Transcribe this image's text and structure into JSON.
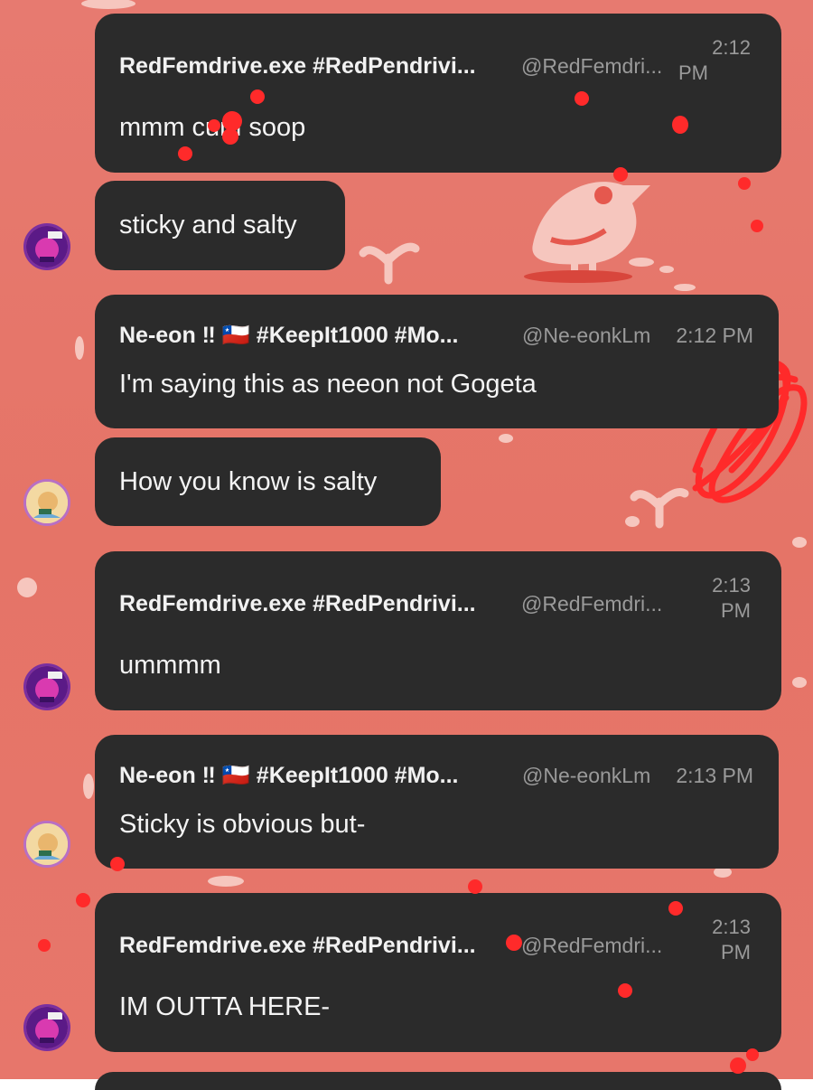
{
  "messages": [
    {
      "name": "RedFemdrive.exe #RedPendrivi...",
      "handle": "@RedFemdri...",
      "time_line1": "2:12",
      "time_line2": "PM",
      "text": "mmm cum soop"
    },
    {
      "text": "sticky and salty"
    },
    {
      "name": "Ne-eon ‼ 🇨🇱 #KeepIt1000 #Mo...",
      "handle": "@Ne-eonkLm",
      "time": "2:12 PM",
      "text": "I'm saying this as neeon not Gogeta"
    },
    {
      "text": "How you know is salty"
    },
    {
      "name": "RedFemdrive.exe #RedPendrivi...",
      "handle": "@RedFemdri...",
      "time_line1": "2:13",
      "time_line2": "PM",
      "text": "ummmm"
    },
    {
      "name": "Ne-eon ‼ 🇨🇱 #KeepIt1000 #Mo...",
      "handle": "@Ne-eonkLm",
      "time": "2:13 PM",
      "text": "Sticky is obvious but-"
    },
    {
      "name": "RedFemdrive.exe #RedPendrivi...",
      "handle": "@RedFemdri...",
      "time_line1": "2:13",
      "time_line2": "PM",
      "text": "IM OUTTA HERE-"
    }
  ],
  "colors": {
    "background": "#e57467",
    "bubble": "#2b2b2b",
    "text": "#f4f4f4",
    "meta": "#9a9a9a",
    "scribble": "#ff2a2a"
  }
}
